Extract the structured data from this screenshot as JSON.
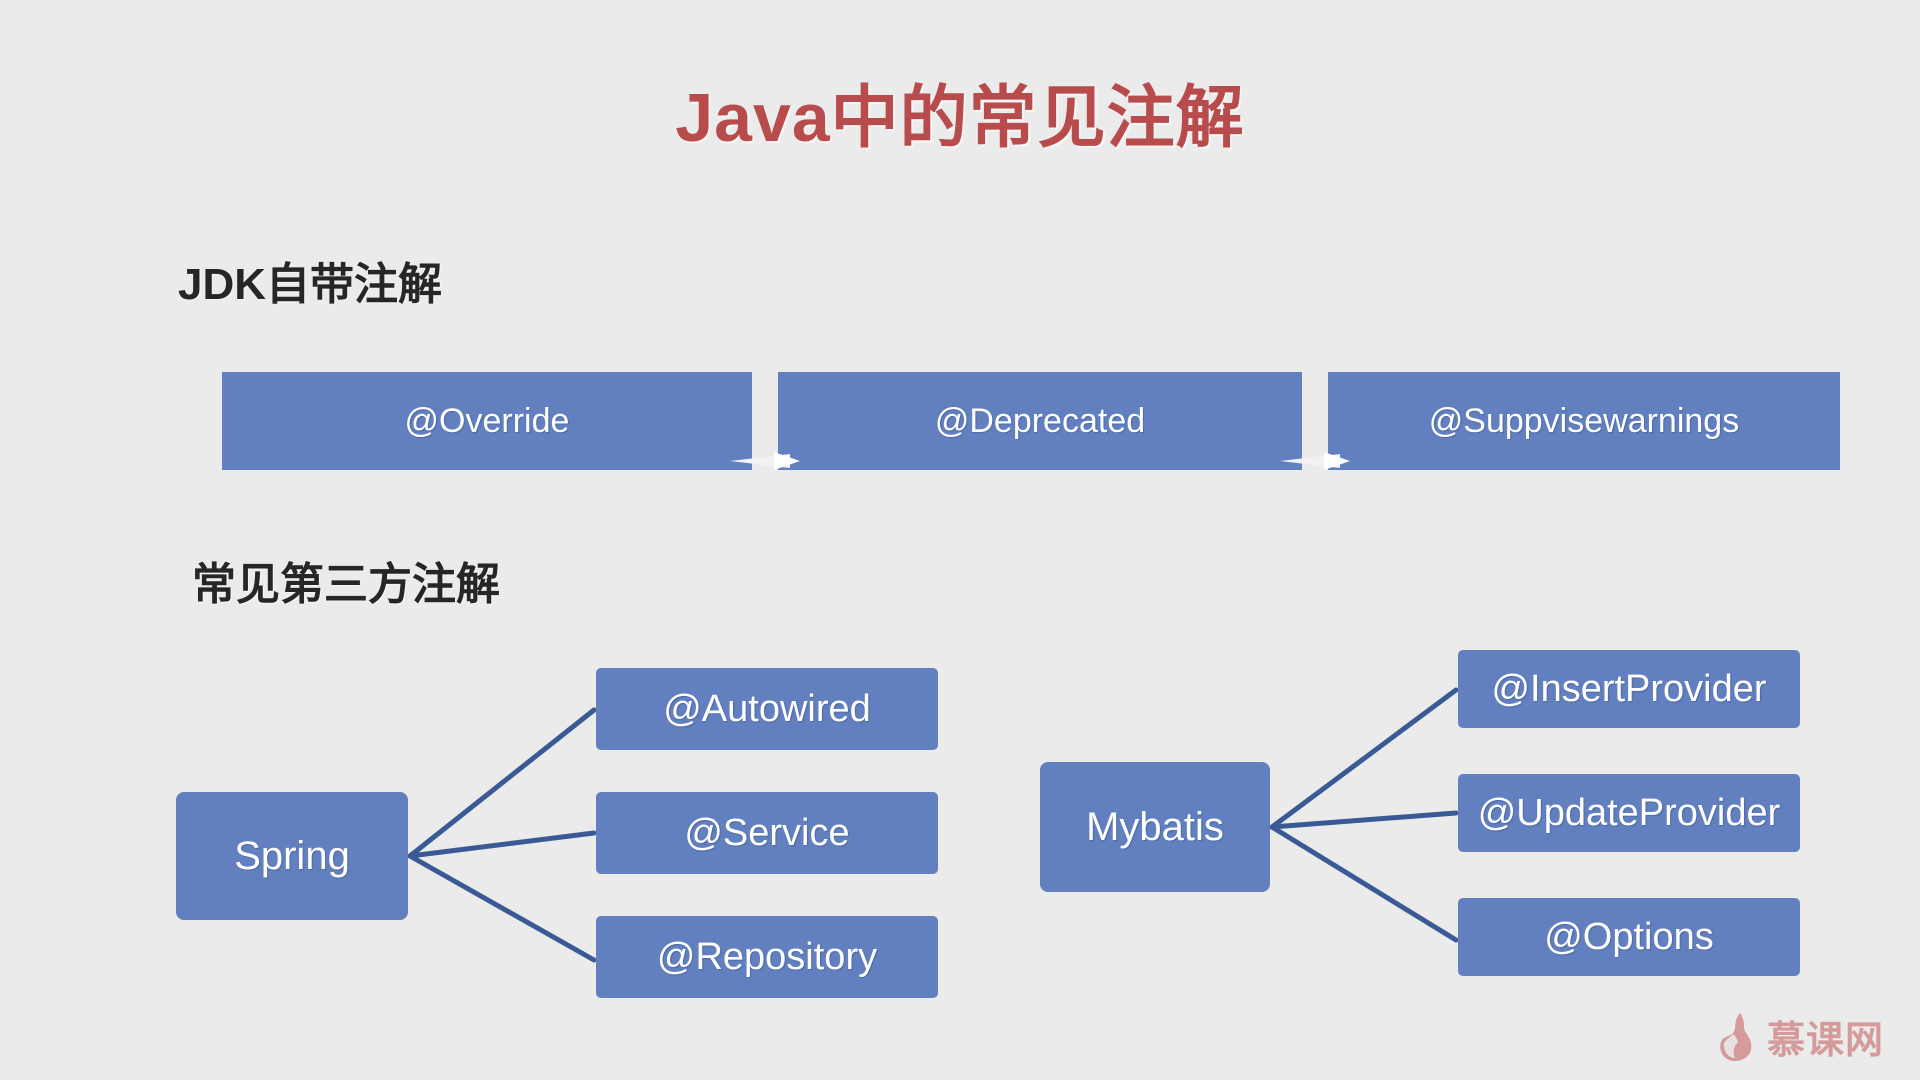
{
  "slide": {
    "title": "Java中的常见注解",
    "background_color": "#ebebeb",
    "title_color": "#b84b4b",
    "node_color": "#6280c0",
    "connector_color": "#3a5a96"
  },
  "sections": {
    "jdk": {
      "heading": "JDK自带注解",
      "blocks": [
        {
          "label": "@Override"
        },
        {
          "label": "@Deprecated"
        },
        {
          "label": "@Suppvisewarnings"
        }
      ]
    },
    "third_party": {
      "heading": "常见第三方注解",
      "groups": [
        {
          "root": "Spring",
          "leaves": [
            {
              "label": "@Autowired"
            },
            {
              "label": "@Service"
            },
            {
              "label": "@Repository"
            }
          ]
        },
        {
          "root": "Mybatis",
          "leaves": [
            {
              "label": "@InsertProvider"
            },
            {
              "label": "@UpdateProvider"
            },
            {
              "label": "@Options"
            }
          ]
        }
      ]
    }
  },
  "watermark": {
    "text": "慕课网",
    "color": "#c96b6b"
  }
}
